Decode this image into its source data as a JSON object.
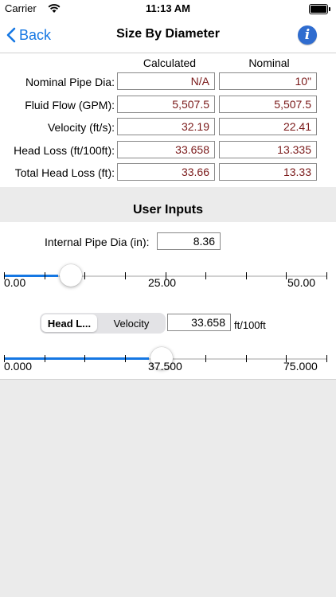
{
  "status": {
    "carrier": "Carrier",
    "time": "11:13 AM"
  },
  "nav": {
    "back_label": "Back",
    "title": "Size By Diameter"
  },
  "table": {
    "col_calculated": "Calculated",
    "col_nominal": "Nominal",
    "rows": [
      {
        "label": "Nominal Pipe Dia:",
        "calculated": "N/A",
        "nominal": "10\""
      },
      {
        "label": "Fluid Flow (GPM):",
        "calculated": "5,507.5",
        "nominal": "5,507.5"
      },
      {
        "label": "Velocity (ft/s):",
        "calculated": "32.19",
        "nominal": "22.41"
      },
      {
        "label": "Head Loss (ft/100ft):",
        "calculated": "33.658",
        "nominal": "13.335"
      },
      {
        "label": "Total Head Loss (ft):",
        "calculated": "33.66",
        "nominal": "13.33"
      }
    ]
  },
  "user_inputs": {
    "section_title": "User Inputs",
    "pipe_dia_label": "Internal Pipe Dia (in):",
    "pipe_dia_value": "8.36",
    "slider1": {
      "min_label": "0.00",
      "mid_label": "25.00",
      "max_label": "50.00",
      "min": 0,
      "max": 50,
      "value": 8.36
    },
    "segment": {
      "selected": "Head L...",
      "other": "Velocity"
    },
    "headloss_value": "33.658",
    "headloss_unit": "ft/100ft",
    "slider2": {
      "min_label": "0.000",
      "mid_label": "37.500",
      "max_label": "75.000",
      "min": 0,
      "max": 75,
      "value": 33.658
    }
  },
  "colors": {
    "accent": "#1577e3",
    "value_text": "#7a1919",
    "info_button": "#2f6ccf"
  },
  "icons": {
    "back": "chevron-left-icon",
    "info": "info-icon",
    "wifi": "wifi-icon",
    "battery": "battery-icon"
  }
}
